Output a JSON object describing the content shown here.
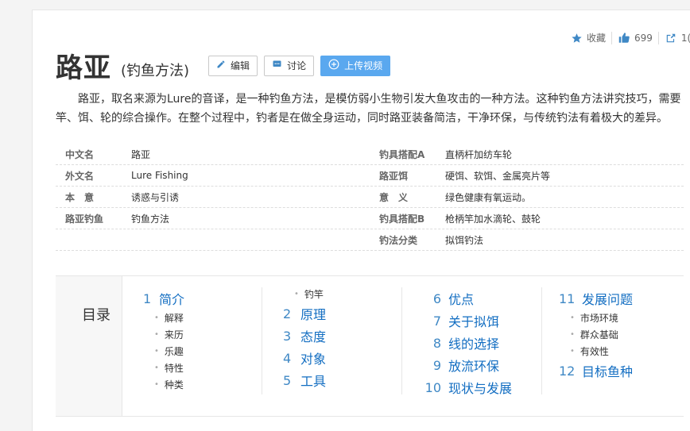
{
  "header": {
    "title": "路亚",
    "subtitle": "(钓鱼方法)",
    "buttons": {
      "edit": "编辑",
      "discuss": "讨论",
      "upload": "上传视频"
    },
    "actions": {
      "favorite": "收藏",
      "like_count": "699",
      "share_count": "1("
    }
  },
  "summary": "路亚，取名来源为Lure的音译，是一种钓鱼方法，是模仿弱小生物引发大鱼攻击的一种方法。这种钓鱼方法讲究技巧，需要竿、饵、轮的综合操作。在整个过程中，钓者是在做全身运动，同时路亚装备简洁，干净环保，与传统钓法有着极大的差异。",
  "infobox": {
    "rows": [
      {
        "k1": "中文名",
        "v1": "路亚",
        "k2": "钓具搭配A",
        "v2": "直柄杆加纺车轮"
      },
      {
        "k1": "外文名",
        "v1": "Lure Fishing",
        "k2": "路亚饵",
        "v2": "硬饵、软饵、金属亮片等"
      },
      {
        "k1": "本　意",
        "v1": "诱惑与引诱",
        "k2": "意　义",
        "v2": "绿色健康有氧运动。"
      },
      {
        "k1": "路亚钓鱼",
        "v1": "钓鱼方法",
        "k2": "钓具搭配B",
        "v2": "枪柄竿加水滴轮、鼓轮"
      },
      {
        "k1": "",
        "v1": "",
        "k2": "钓法分类",
        "v2": "拟饵钓法"
      }
    ]
  },
  "toc": {
    "label": "目录",
    "col1": {
      "h1": {
        "num": "1",
        "label": "简介"
      },
      "subs": [
        "解释",
        "来历",
        "乐趣",
        "特性",
        "种类"
      ]
    },
    "col2": {
      "sub_top": "钓竿",
      "items": [
        {
          "num": "2",
          "label": "原理"
        },
        {
          "num": "3",
          "label": "态度"
        },
        {
          "num": "4",
          "label": "对象"
        },
        {
          "num": "5",
          "label": "工具"
        }
      ]
    },
    "col3": {
      "items": [
        {
          "num": "6",
          "label": "优点"
        },
        {
          "num": "7",
          "label": "关于拟饵"
        },
        {
          "num": "8",
          "label": "线的选择"
        },
        {
          "num": "9",
          "label": "放流环保"
        },
        {
          "num": "10",
          "label": "现状与发展"
        }
      ]
    },
    "col4": {
      "h1": {
        "num": "11",
        "label": "发展问题"
      },
      "subs": [
        "市场环境",
        "群众基础",
        "有效性"
      ],
      "h1b": {
        "num": "12",
        "label": "目标鱼种"
      }
    }
  },
  "colors": {
    "link": "#136ec2",
    "primary_button": "#5aa8ef",
    "icon_blue": "#3f88c5"
  }
}
